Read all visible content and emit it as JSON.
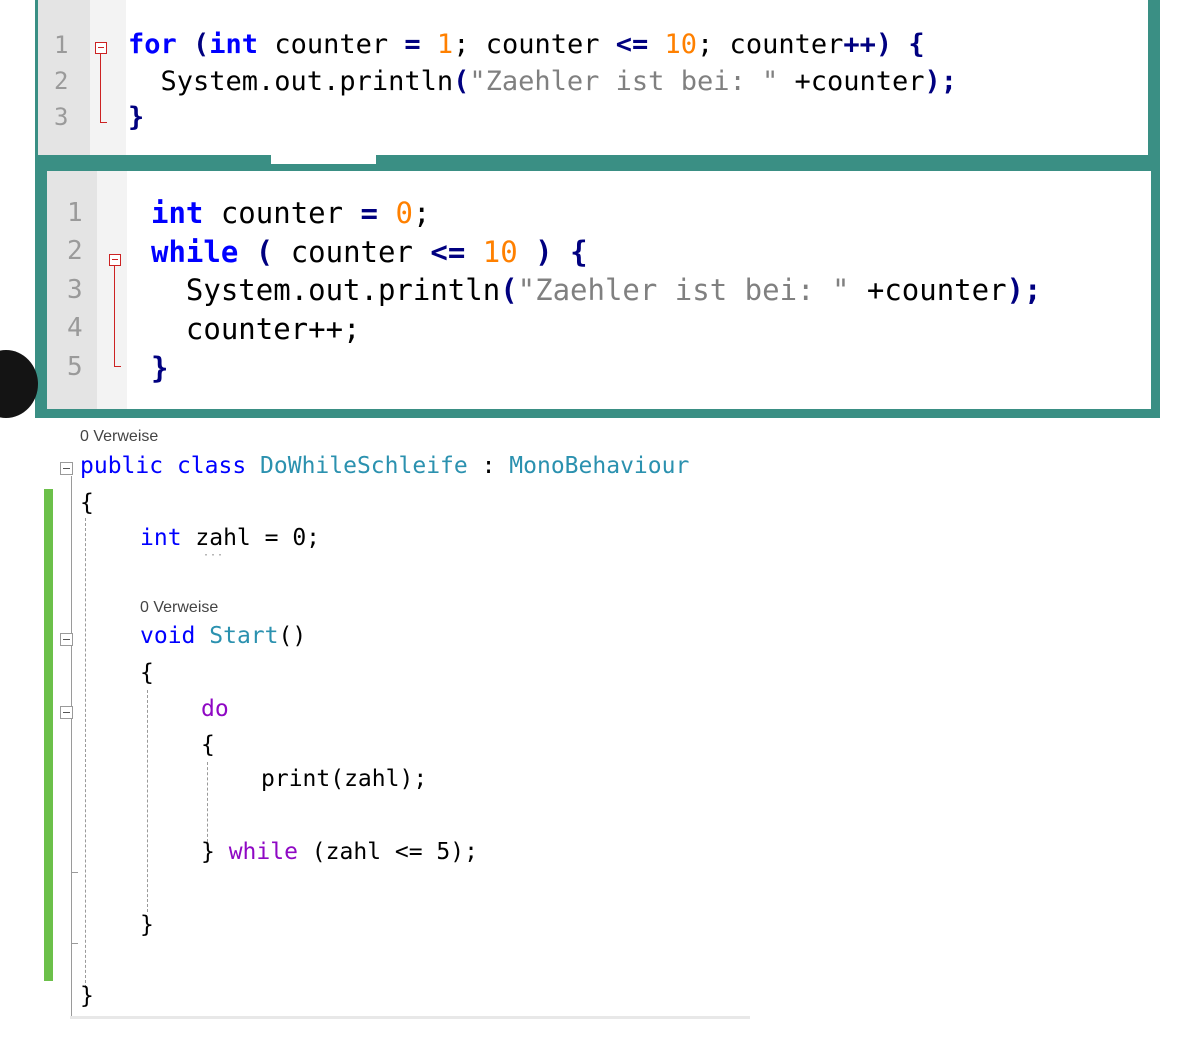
{
  "panel1": {
    "line_numbers": [
      "1",
      "2",
      "3"
    ],
    "line1": {
      "kw_for": "for",
      "open": " (",
      "kw_int": "int",
      "var1": " counter ",
      "assign": "=",
      "sp1": " ",
      "start": "1",
      "semi1": "; counter ",
      "le": "<=",
      "sp2": " ",
      "limit": "10",
      "semi2": "; counter",
      "inc": "++) {"
    },
    "line2": {
      "method": "  System.out.println",
      "paren": "(",
      "str": "\"Zaehler ist bei: \"",
      "rest": " +counter",
      "close": ");"
    },
    "line3": "}"
  },
  "panel2": {
    "line_numbers": [
      "1",
      "2",
      "3",
      "4",
      "5"
    ],
    "line1": {
      "kw_int": "int",
      "var": " counter ",
      "assign": "=",
      "sp": " ",
      "val": "0",
      "semi": ";"
    },
    "line2": {
      "kw_while": "while",
      "open": " ( ",
      "var": "counter ",
      "le": "<=",
      "sp": " ",
      "limit": "10",
      "close": " ) {"
    },
    "line3": {
      "method": "  System.out.println",
      "paren": "(",
      "str": "\"Zaehler ist bei: \"",
      "rest": " +counter",
      "close": ");"
    },
    "line4": "  counter++;",
    "line5": "}"
  },
  "panel3": {
    "ref_label_1": "0 Verweise",
    "class_line": {
      "kw_public": "public",
      "kw_class": " class ",
      "class_name": "DoWhileSchleife",
      "colon": " : ",
      "base": "MonoBehaviour"
    },
    "open_brace_1": "{",
    "field_line": {
      "kw_int": "int",
      "rest": " zahl = 0;"
    },
    "ref_label_2": "0 Verweise",
    "method_line": {
      "kw_void": "void",
      "sp": " ",
      "name": "Start",
      "parens": "()"
    },
    "open_brace_2": "{",
    "do_kw": "do",
    "open_brace_3": "{",
    "print_line": "print(zahl);",
    "while_line": {
      "close": "} ",
      "kw_while": "while",
      "rest": " (zahl <= 5);"
    },
    "close_brace_2": "}",
    "close_brace_1": "}"
  },
  "colors": {
    "frame": "#3a8f84",
    "np_keyword": "#0000ff",
    "np_number": "#ff8000",
    "np_string": "#808080",
    "vs_keyword": "#0000ff",
    "vs_type": "#2b91af",
    "vs_control": "#8f08c4",
    "vs_changed_bar": "#6cc04a"
  }
}
